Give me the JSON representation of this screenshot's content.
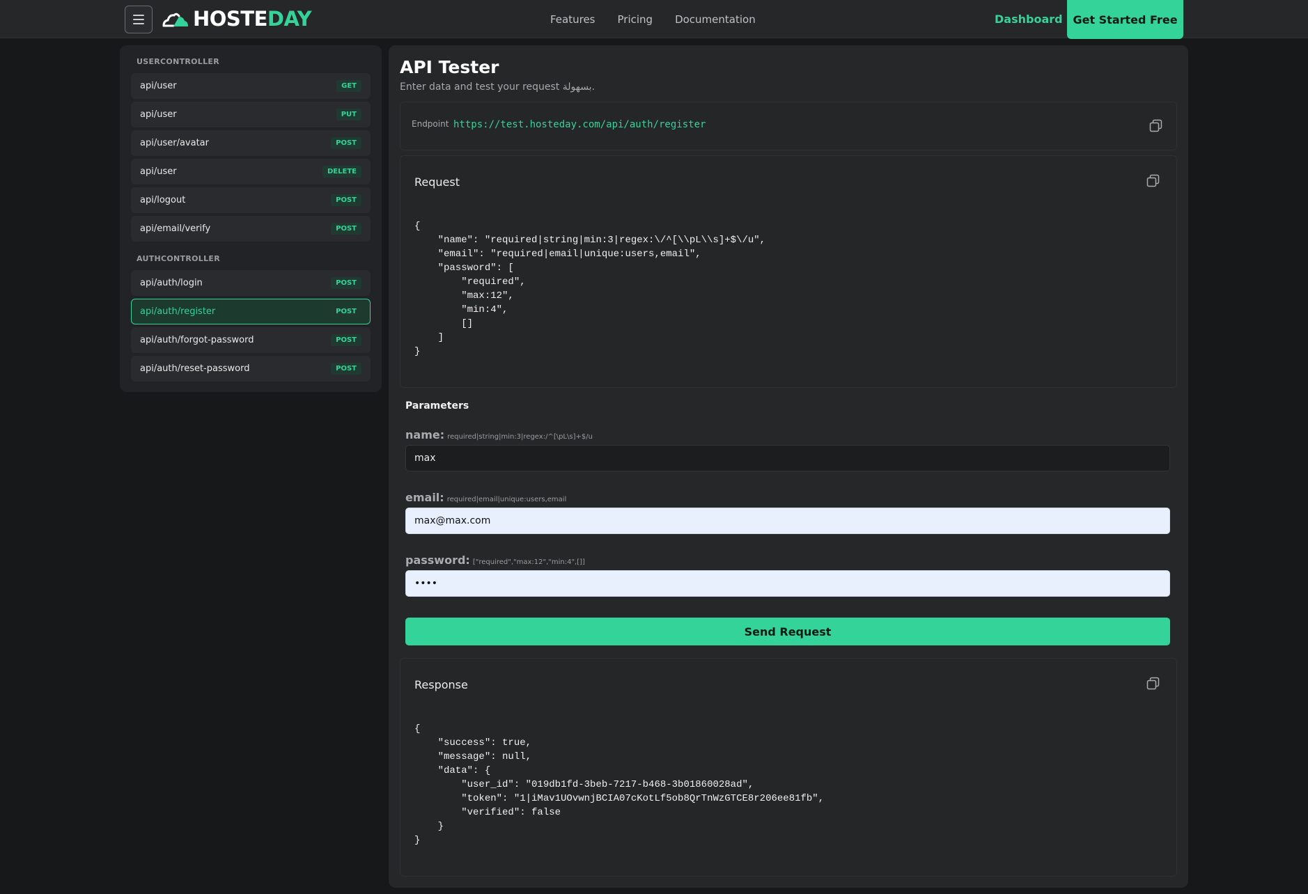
{
  "nav": {
    "logo_host": "HOSTE",
    "logo_day": "DAY",
    "links": [
      "Features",
      "Pricing",
      "Documentation"
    ],
    "dashboard": "Dashboard",
    "cta": "Get Started Free"
  },
  "sidebar": {
    "groups": [
      {
        "title": "USERCONTROLLER",
        "items": [
          {
            "path": "api/user",
            "method": "GET"
          },
          {
            "path": "api/user",
            "method": "PUT"
          },
          {
            "path": "api/user/avatar",
            "method": "POST"
          },
          {
            "path": "api/user",
            "method": "DELETE"
          },
          {
            "path": "api/logout",
            "method": "POST"
          },
          {
            "path": "api/email/verify",
            "method": "POST"
          }
        ]
      },
      {
        "title": "AUTHCONTROLLER",
        "items": [
          {
            "path": "api/auth/login",
            "method": "POST"
          },
          {
            "path": "api/auth/register",
            "method": "POST",
            "active": true
          },
          {
            "path": "api/auth/forgot-password",
            "method": "POST"
          },
          {
            "path": "api/auth/reset-password",
            "method": "POST"
          }
        ]
      }
    ]
  },
  "main": {
    "title": "API Tester",
    "subtitle": "Enter data and test your request بسهولة.",
    "endpoint_label": "Endpoint",
    "endpoint_url": "https://test.hosteday.com/api/auth/register",
    "request_title": "Request",
    "request_body": "{\n    \"name\": \"required|string|min:3|regex:\\/^[\\\\pL\\\\s]+$\\/u\",\n    \"email\": \"required|email|unique:users,email\",\n    \"password\": [\n        \"required\",\n        \"max:12\",\n        \"min:4\",\n        []\n    ]\n}",
    "params_title": "Parameters",
    "fields": [
      {
        "name": "name:",
        "rule": "required|string|min:3|regex:/^[\\pL\\s]+$/u",
        "value": "max"
      },
      {
        "name": "email:",
        "rule": "required|email|unique:users,email",
        "value": "max@max.com"
      },
      {
        "name": "password:",
        "rule": "[\"required\",\"max:12\",\"min:4\",[]]",
        "value": "••••"
      }
    ],
    "send_label": "Send Request",
    "response_title": "Response",
    "response_body": "{\n    \"success\": true,\n    \"message\": null,\n    \"data\": {\n        \"user_id\": \"019db1fd-3beb-7217-b468-3b01860028ad\",\n        \"token\": \"1|iMav1UOvwnjBCIA07cKotLf5ob8QrTnWzGTCE8r206ee81fb\",\n        \"verified\": false\n    }\n}"
  },
  "colors": {
    "accent": "#34d399",
    "background": "#17181a",
    "panel": "#262729"
  },
  "icons": {
    "menu": "hamburger-icon",
    "logo": "cloud-logo-icon",
    "copy": "copy-icon"
  }
}
